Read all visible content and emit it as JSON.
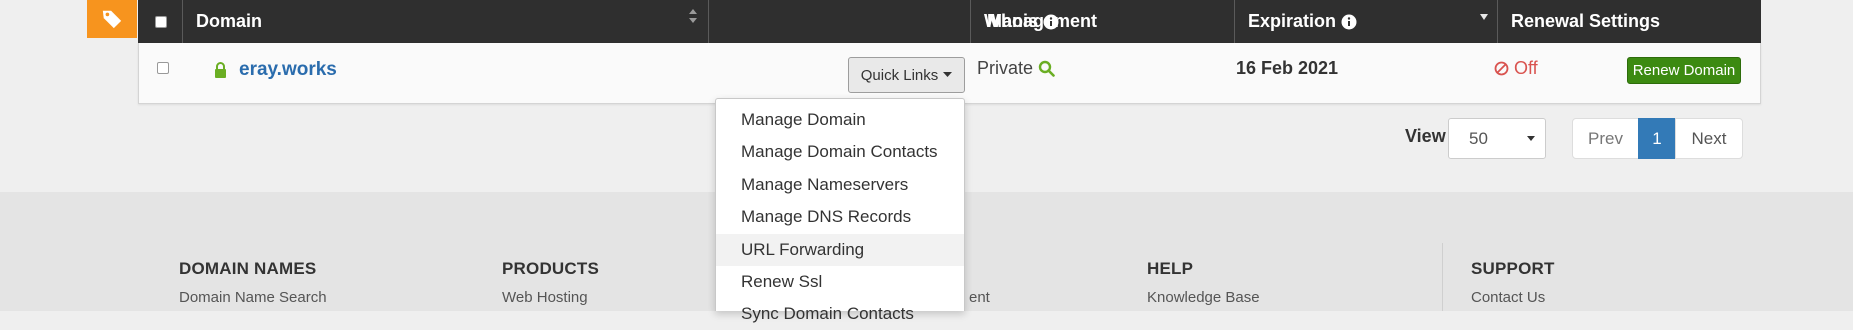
{
  "table": {
    "headers": {
      "domain": "Domain",
      "management": "Management",
      "whois": "Whois",
      "expiration": "Expiration",
      "renewal_settings": "Renewal Settings"
    }
  },
  "row": {
    "domain": "eray.works",
    "quick_links": "Quick Links",
    "whois": "Private",
    "expiration": "16 Feb 2021",
    "auto_renew": "Off",
    "renew_button": "Renew Domain"
  },
  "quick_links_menu": [
    "Manage Domain",
    "Manage Domain Contacts",
    "Manage Nameservers",
    "Manage DNS Records",
    "URL Forwarding",
    "Renew Ssl",
    "Sync Domain Contacts"
  ],
  "pagination": {
    "view_label": "View",
    "per_page": "50",
    "prev": "Prev",
    "page": "1",
    "next": "Next"
  },
  "footer": {
    "domain_names": {
      "title": "DOMAIN NAMES",
      "link": "Domain Name Search"
    },
    "products": {
      "title": "PRODUCTS",
      "link": "Web Hosting"
    },
    "partial_link": "ent",
    "help": {
      "title": "HELP",
      "link": "Knowledge Base"
    },
    "support": {
      "title": "SUPPORT",
      "link": "Contact Us"
    }
  },
  "colors": {
    "accent_orange": "#f7941e",
    "header_dark": "#2f2f2f",
    "domain_link": "#2a6cad",
    "renew_green": "#3c8a11",
    "off_red": "#d9534f",
    "lock_green": "#6aae23",
    "page_active": "#337ab7"
  },
  "icons": {
    "tag": "tag-icon",
    "sort": "sort-icon",
    "info": "info-icon",
    "lock": "lock-icon",
    "caret": "caret-down-icon",
    "search": "search-icon",
    "ban": "ban-icon"
  }
}
